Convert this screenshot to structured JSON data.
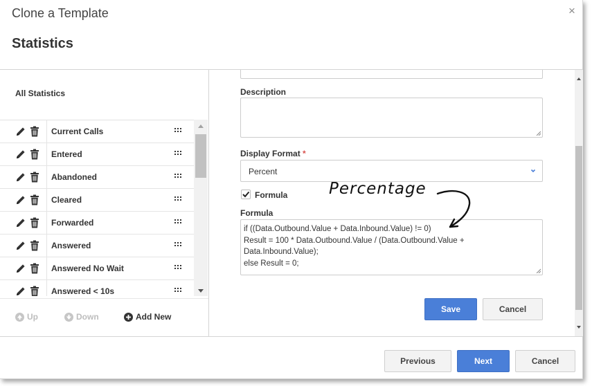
{
  "dialog": {
    "title": "Clone a Template",
    "close_glyph": "×",
    "section_title": "Statistics"
  },
  "left_panel": {
    "heading": "All Statistics",
    "items": [
      {
        "label": "Current Calls"
      },
      {
        "label": "Entered"
      },
      {
        "label": "Abandoned"
      },
      {
        "label": "Cleared"
      },
      {
        "label": "Forwarded"
      },
      {
        "label": "Answered"
      },
      {
        "label": "Answered No Wait"
      },
      {
        "label": "Answered < 10s"
      }
    ],
    "controls": {
      "up": "Up",
      "down": "Down",
      "add_new": "Add New"
    }
  },
  "form": {
    "description_label": "Description",
    "description_value": "",
    "display_format_label": "Display Format",
    "required_marker": "*",
    "display_format_value": "Percent",
    "formula_checkbox_label": "Formula",
    "formula_checked": true,
    "formula_label": "Formula",
    "formula_lines": [
      "if ((Data.Outbound.Value + Data.Inbound.Value) != 0)",
      "Result = 100 * Data.Outbound.Value / (Data.Outbound.Value +",
      "Data.Inbound.Value);",
      "else Result = 0;"
    ],
    "save_label": "Save",
    "cancel_label": "Cancel"
  },
  "annotation": {
    "text": "Percentage"
  },
  "footer": {
    "previous_label": "Previous",
    "next_label": "Next",
    "cancel_label": "Cancel"
  },
  "colors": {
    "primary": "#4a7fd8",
    "required": "#d9534f"
  },
  "icons": [
    "close-icon",
    "pencil-icon",
    "trash-icon",
    "drag-handle-icon",
    "arrow-up-circle-icon",
    "arrow-down-circle-icon",
    "plus-circle-icon",
    "chevron-down-icon",
    "checkmark-icon"
  ]
}
